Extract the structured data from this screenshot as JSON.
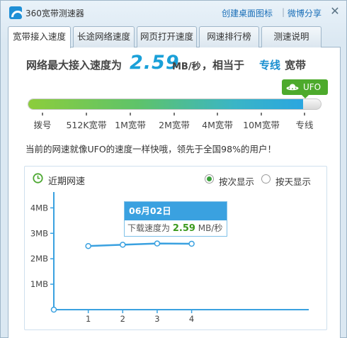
{
  "window": {
    "title": "360宽带测速器",
    "link_desktop_icon": "创建桌面图标",
    "separator": "|",
    "link_weibo_share": "微博分享",
    "close_glyph": "✕"
  },
  "tabs": [
    {
      "label": "宽带接入速度",
      "active": true
    },
    {
      "label": "长途网络速度",
      "active": false
    },
    {
      "label": "网页打开速度",
      "active": false
    },
    {
      "label": "网速排行榜",
      "active": false
    },
    {
      "label": "测速说明",
      "active": false
    }
  ],
  "result": {
    "prefix": "网络最大接入速度为",
    "speed": "2.59",
    "unit": "MB/秒",
    "equiv": "，相当于",
    "level": "专线",
    "suffix": "宽带",
    "badge": "UFO"
  },
  "speed_bar": {
    "fill_fraction": 0.94,
    "levels": [
      "拨号",
      "512K宽带",
      "1M宽带",
      "2M宽带",
      "4M宽带",
      "10M宽带",
      "专线"
    ]
  },
  "comparison": "当前的网速就像UFO的速度一样快哦，领先于全国98%的用户！",
  "chart_panel": {
    "heading": "近期网速",
    "options": [
      {
        "label": "按次显示",
        "selected": true
      },
      {
        "label": "按天显示",
        "selected": false
      }
    ]
  },
  "chart_data": {
    "type": "line",
    "x": [
      1,
      2,
      3,
      4
    ],
    "xticks": [
      "1",
      "2",
      "3",
      "4"
    ],
    "y": [
      2.5,
      2.55,
      2.6,
      2.59
    ],
    "yticks": [
      "1MB",
      "2MB",
      "3MB",
      "4MB"
    ],
    "ylim": [
      0,
      4.4
    ],
    "xlim": [
      0,
      7.4
    ],
    "color": "#3aa1e0"
  },
  "tooltip": {
    "date": "06月02日",
    "label": "下载速度为",
    "value": "2.59",
    "unit": "MB/秒"
  },
  "colors": {
    "accent": "#3aa1e0",
    "ufo_green": "#4daa2c",
    "speed_blue": "#1aa0d8"
  }
}
